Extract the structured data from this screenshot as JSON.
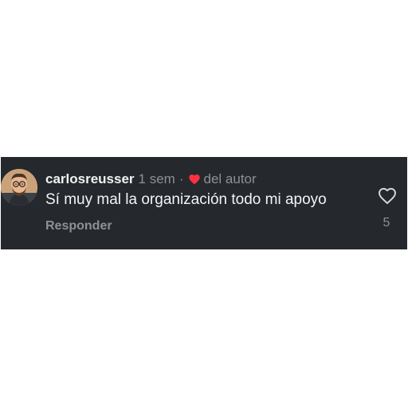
{
  "comment": {
    "username": "carlosreusser",
    "time": "1 sem",
    "separator": "·",
    "author_like_label": "del autor",
    "text": "Sí muy mal la organización todo mi apoyo",
    "reply_label": "Responder",
    "like_count": "5"
  },
  "icons": {
    "author_heart": "heart-filled-icon",
    "like": "heart-outline-icon",
    "avatar": "avatar-illustration"
  },
  "colors": {
    "card_background": "#25282d",
    "username": "#f2f2f2",
    "secondary_text": "#8e9095",
    "heart_red": "#ff3040"
  }
}
